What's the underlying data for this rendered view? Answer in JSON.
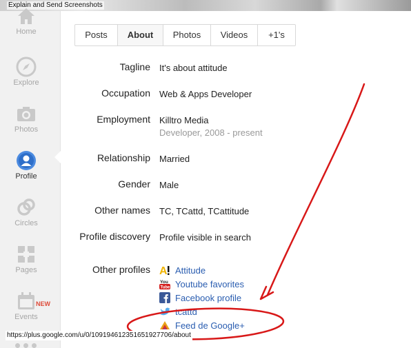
{
  "banner": {
    "title": "Explain and Send Screenshots"
  },
  "sidebar": {
    "items": [
      {
        "label": "Home",
        "icon": "home-icon"
      },
      {
        "label": "Explore",
        "icon": "compass-icon"
      },
      {
        "label": "Photos",
        "icon": "camera-icon"
      },
      {
        "label": "Profile",
        "icon": "profile-icon",
        "active": true
      },
      {
        "label": "Circles",
        "icon": "circles-icon"
      },
      {
        "label": "Pages",
        "icon": "pages-icon"
      },
      {
        "label": "Events",
        "icon": "calendar-icon",
        "badge": "NEW"
      }
    ]
  },
  "tabs": [
    {
      "label": "Posts"
    },
    {
      "label": "About",
      "active": true
    },
    {
      "label": "Photos"
    },
    {
      "label": "Videos"
    },
    {
      "label": "+1's"
    }
  ],
  "about": {
    "tagline": {
      "label": "Tagline",
      "value": "It's about attitude"
    },
    "occupation": {
      "label": "Occupation",
      "value": "Web & Apps Developer"
    },
    "employment": {
      "label": "Employment",
      "value": "Killtro Media",
      "detail": "Developer, 2008 - present"
    },
    "relationship": {
      "label": "Relationship",
      "value": "Married"
    },
    "gender": {
      "label": "Gender",
      "value": "Male"
    },
    "other_names": {
      "label": "Other names",
      "value": "TC, TCattd, TCattitude"
    },
    "profile_discovery": {
      "label": "Profile discovery",
      "value": "Profile visible in search"
    },
    "other_profiles": {
      "label": "Other profiles",
      "links": [
        {
          "text": "Attitude",
          "icon": "attitude-a-icon"
        },
        {
          "text": "Youtube favorites",
          "icon": "youtube-icon"
        },
        {
          "text": "Facebook profile",
          "icon": "facebook-icon"
        },
        {
          "text": "tcattd",
          "icon": "twitter-icon"
        },
        {
          "text": "Feed de Google+",
          "icon": "feed-icon"
        }
      ]
    }
  },
  "status_bar": {
    "url": "https://plus.google.com/u/0/109194612351651927706/about"
  },
  "colors": {
    "link": "#2a5db0",
    "annotation_red": "#d81818",
    "badge_red": "#dd4b39",
    "sidebar_bg": "#f1f1f1"
  }
}
